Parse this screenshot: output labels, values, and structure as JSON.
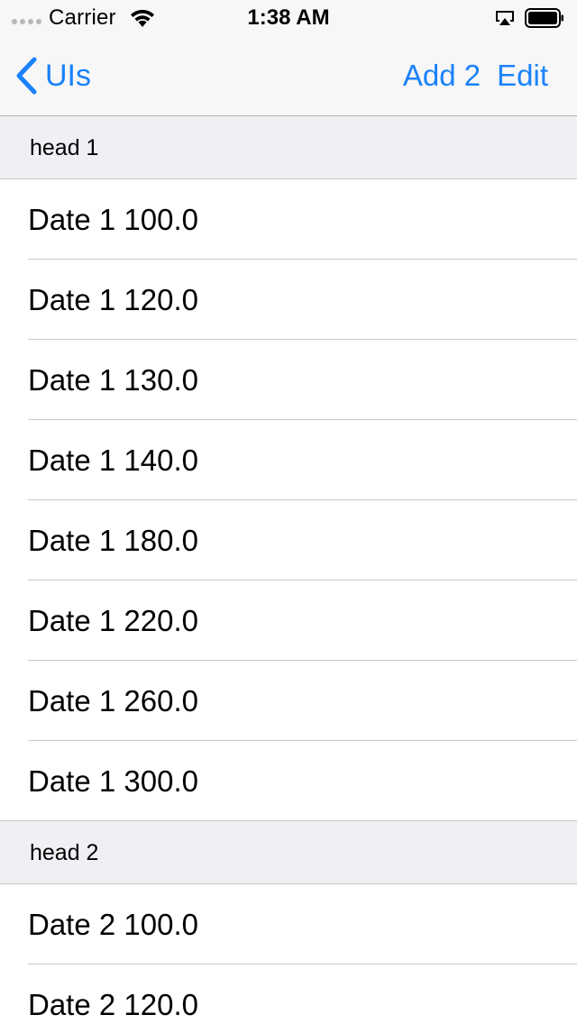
{
  "status_bar": {
    "carrier": "Carrier",
    "time": "1:38 AM",
    "icons": [
      "signal-dots-icon",
      "wifi-icon",
      "airplay-icon",
      "battery-icon"
    ]
  },
  "nav": {
    "back_label": "UIs",
    "back_icon": "chevron-left-icon",
    "add_label": "Add 2",
    "edit_label": "Edit",
    "accent_color": "#1a82fb"
  },
  "sections": [
    {
      "header": "head 1",
      "rows": [
        "Date 1 100.0",
        "Date 1 120.0",
        "Date 1 130.0",
        "Date 1 140.0",
        "Date 1 180.0",
        "Date 1 220.0",
        "Date 1 260.0",
        "Date 1 300.0"
      ]
    },
    {
      "header": "head 2",
      "rows": [
        "Date 2 100.0",
        "Date 2 120.0"
      ]
    }
  ]
}
